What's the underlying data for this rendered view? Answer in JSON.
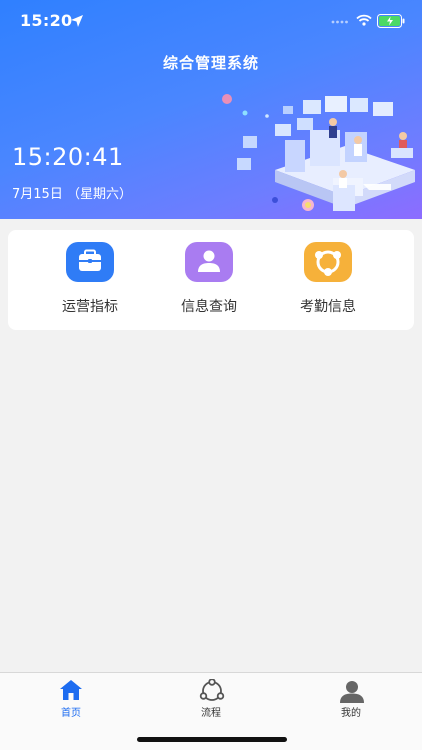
{
  "status_bar": {
    "time": "15:20"
  },
  "header": {
    "title": "综合管理系统",
    "clock": "15:20:41",
    "date": "7月15日 （星期六）"
  },
  "menu": {
    "items": [
      {
        "label": "运营指标",
        "icon": "briefcase-icon",
        "color": "#2f7cf6"
      },
      {
        "label": "信息查询",
        "icon": "user-icon",
        "color": "#a97cf1"
      },
      {
        "label": "考勤信息",
        "icon": "attendance-icon",
        "color": "#f6b13a"
      }
    ]
  },
  "tabbar": {
    "tabs": [
      {
        "label": "首页",
        "icon": "home-icon",
        "active": true
      },
      {
        "label": "流程",
        "icon": "process-icon",
        "active": false
      },
      {
        "label": "我的",
        "icon": "person-icon",
        "active": false
      }
    ],
    "active_color": "#1d6cf0"
  }
}
